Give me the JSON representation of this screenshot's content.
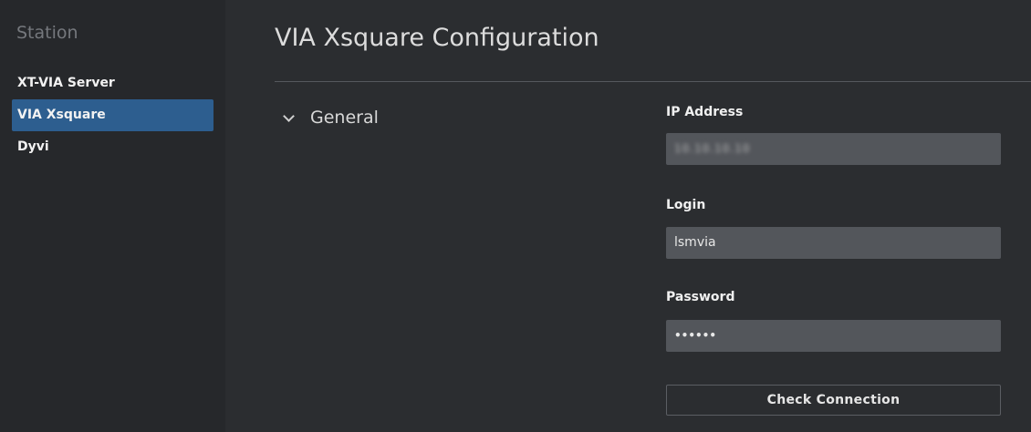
{
  "sidebar": {
    "title": "Station",
    "items": [
      {
        "label": "XT-VIA Server",
        "active": false
      },
      {
        "label": "VIA Xsquare",
        "active": true
      },
      {
        "label": "Dyvi",
        "active": false
      }
    ]
  },
  "main": {
    "title": "VIA Xsquare Configuration",
    "section": {
      "label": "General",
      "expanded": true,
      "icon": "chevron-down-icon"
    },
    "fields": {
      "ip_address": {
        "label": "IP Address",
        "value": "10.10.10.10"
      },
      "login": {
        "label": "Login",
        "value": "lsmvia"
      },
      "password": {
        "label": "Password",
        "value": "••••••"
      }
    },
    "check_button_label": "Check Connection"
  },
  "colors": {
    "background": "#2b2d30",
    "sidebar_background": "#26282b",
    "accent": "#2d5e8f",
    "input_background": "#53565b"
  }
}
